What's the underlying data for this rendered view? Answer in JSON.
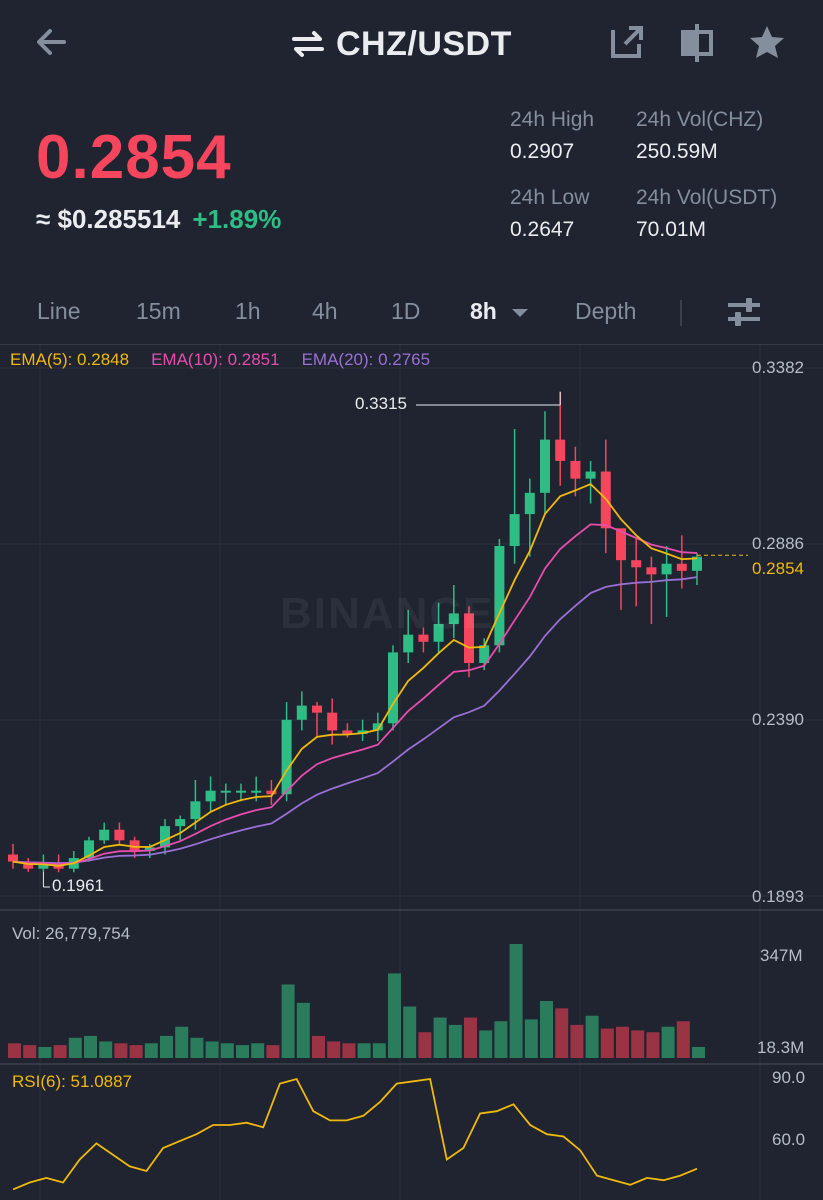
{
  "header": {
    "pair": "CHZ/USDT",
    "icons": [
      "back-arrow-icon",
      "swap-icon",
      "share-icon",
      "split-view-icon",
      "star-icon"
    ]
  },
  "ticker": {
    "last_price": "0.2854",
    "fiat_price": "≈ $0.285514",
    "change_pct": "+1.89%",
    "price_color": "#f6465d",
    "change_color": "#2ebd85"
  },
  "stats": {
    "high_label": "24h High",
    "high_value": "0.2907",
    "vol_chz_label": "24h Vol(CHZ)",
    "vol_chz_value": "250.59M",
    "low_label": "24h Low",
    "low_value": "0.2647",
    "vol_usdt_label": "24h Vol(USDT)",
    "vol_usdt_value": "70.01M"
  },
  "tabs": {
    "line": "Line",
    "m15": "15m",
    "h1": "1h",
    "h4": "4h",
    "d1": "1D",
    "h8": "8h",
    "depth": "Depth",
    "active": "8h"
  },
  "chart_data": {
    "type": "candlestick",
    "interval": "8h",
    "ema": {
      "ema5_label": "EMA(5): 0.2848",
      "ema10_label": "EMA(10): 0.2851",
      "ema20_label": "EMA(20): 0.2765",
      "colors": {
        "ema5": "#f0b90b",
        "ema10": "#e84dae",
        "ema20": "#9b6fd6"
      }
    },
    "price_axis": {
      "ticks": [
        "0.3382",
        "0.2886",
        "0.2390",
        "0.1893"
      ],
      "ylim": [
        0.1893,
        0.3382
      ]
    },
    "current_price": "0.2854",
    "high_marker": "0.3315",
    "low_marker": "0.1961",
    "watermark": "BINANCE",
    "candles": [
      [
        0.201,
        0.204,
        0.197,
        0.199
      ],
      [
        0.199,
        0.2,
        0.1961,
        0.197
      ],
      [
        0.197,
        0.201,
        0.196,
        0.198
      ],
      [
        0.198,
        0.201,
        0.196,
        0.197
      ],
      [
        0.197,
        0.202,
        0.196,
        0.2
      ],
      [
        0.2,
        0.206,
        0.199,
        0.205
      ],
      [
        0.205,
        0.21,
        0.204,
        0.208
      ],
      [
        0.208,
        0.21,
        0.204,
        0.205
      ],
      [
        0.205,
        0.206,
        0.2,
        0.202
      ],
      [
        0.202,
        0.204,
        0.2,
        0.203
      ],
      [
        0.203,
        0.211,
        0.201,
        0.209
      ],
      [
        0.209,
        0.212,
        0.205,
        0.211
      ],
      [
        0.211,
        0.222,
        0.208,
        0.216
      ],
      [
        0.216,
        0.223,
        0.213,
        0.219
      ],
      [
        0.219,
        0.221,
        0.215,
        0.219
      ],
      [
        0.219,
        0.221,
        0.216,
        0.219
      ],
      [
        0.219,
        0.223,
        0.216,
        0.219
      ],
      [
        0.219,
        0.222,
        0.215,
        0.218
      ],
      [
        0.218,
        0.244,
        0.216,
        0.239
      ],
      [
        0.239,
        0.247,
        0.236,
        0.243
      ],
      [
        0.243,
        0.244,
        0.234,
        0.241
      ],
      [
        0.241,
        0.245,
        0.232,
        0.236
      ],
      [
        0.236,
        0.238,
        0.234,
        0.235
      ],
      [
        0.235,
        0.239,
        0.233,
        0.236
      ],
      [
        0.236,
        0.241,
        0.233,
        0.238
      ],
      [
        0.238,
        0.26,
        0.236,
        0.258
      ],
      [
        0.258,
        0.27,
        0.255,
        0.263
      ],
      [
        0.263,
        0.265,
        0.258,
        0.261
      ],
      [
        0.261,
        0.272,
        0.258,
        0.266
      ],
      [
        0.266,
        0.277,
        0.262,
        0.269
      ],
      [
        0.269,
        0.271,
        0.251,
        0.255
      ],
      [
        0.255,
        0.262,
        0.253,
        0.26
      ],
      [
        0.26,
        0.29,
        0.258,
        0.288
      ],
      [
        0.288,
        0.321,
        0.283,
        0.297
      ],
      [
        0.297,
        0.307,
        0.285,
        0.303
      ],
      [
        0.303,
        0.326,
        0.297,
        0.318
      ],
      [
        0.318,
        0.3315,
        0.305,
        0.312
      ],
      [
        0.312,
        0.316,
        0.302,
        0.307
      ],
      [
        0.307,
        0.312,
        0.3,
        0.309
      ],
      [
        0.309,
        0.318,
        0.286,
        0.293
      ],
      [
        0.293,
        0.29,
        0.27,
        0.284
      ],
      [
        0.284,
        0.29,
        0.271,
        0.282
      ],
      [
        0.282,
        0.285,
        0.266,
        0.28
      ],
      [
        0.28,
        0.288,
        0.268,
        0.283
      ],
      [
        0.283,
        0.291,
        0.276,
        0.281
      ],
      [
        0.281,
        0.286,
        0.277,
        0.285
      ]
    ],
    "volume": {
      "label": "Vol: 26,779,754",
      "axis_ticks": [
        "347M",
        "18.3M"
      ],
      "values": [
        40,
        35,
        30,
        35,
        55,
        60,
        45,
        40,
        35,
        40,
        60,
        85,
        55,
        45,
        40,
        35,
        40,
        35,
        200,
        150,
        60,
        45,
        40,
        40,
        40,
        230,
        140,
        70,
        110,
        90,
        110,
        75,
        100,
        310,
        105,
        155,
        135,
        90,
        115,
        80,
        85,
        75,
        70,
        85,
        100,
        30
      ]
    },
    "rsi": {
      "label": "RSI(6): 51.0887",
      "axis_ticks": [
        "90.0",
        "60.0"
      ],
      "values": [
        42,
        45,
        47,
        45,
        55,
        62,
        57,
        52,
        50,
        60,
        63,
        66,
        70,
        70,
        71,
        69,
        88,
        90,
        76,
        72,
        72,
        74,
        80,
        88,
        89,
        90,
        55,
        60,
        75,
        76,
        79,
        70,
        66,
        65,
        59,
        48,
        46,
        44,
        47,
        46,
        48,
        51
      ]
    }
  }
}
